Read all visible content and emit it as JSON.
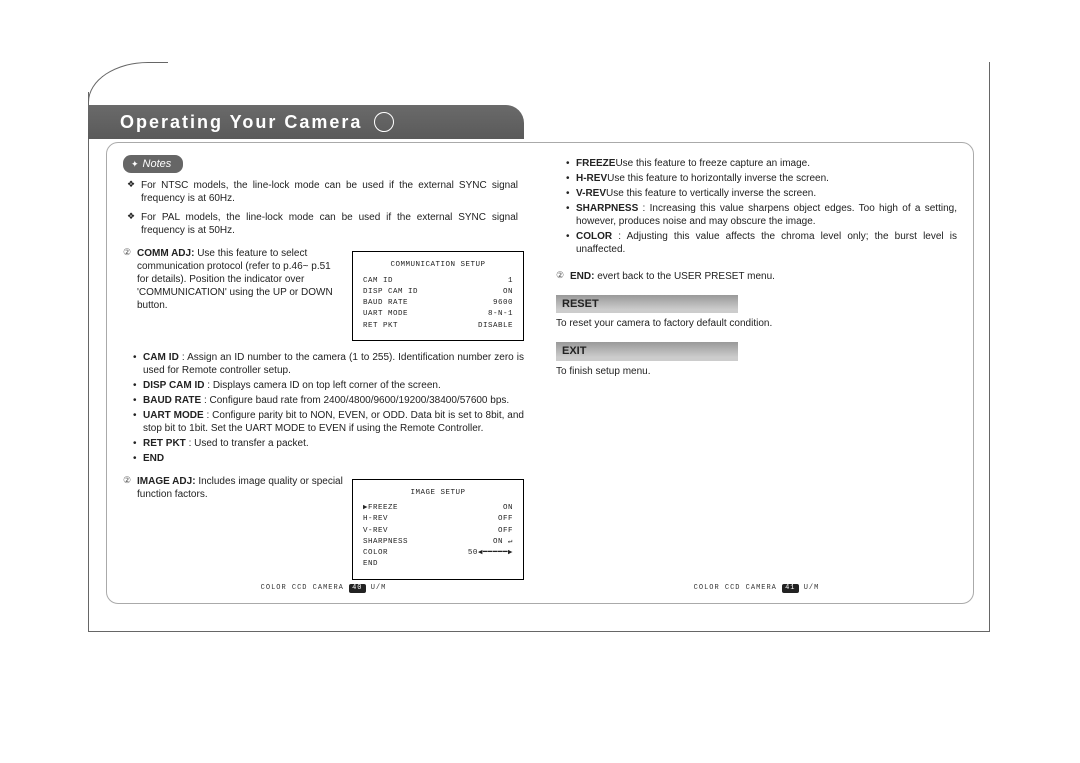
{
  "header": {
    "title": "Operating Your Camera"
  },
  "notes": {
    "label": "Notes"
  },
  "left": {
    "note_ntsc": "For NTSC models, the line-lock mode can be used if the external SYNC signal frequency is at 60Hz.",
    "note_pal": "For PAL models, the line-lock mode  can be used if the external SYNC signal frequency is at 50Hz.",
    "comm_adj_label": "COMM ADJ:",
    "comm_adj_body": "Use this feature to select communication protocol (refer to p.46~ p.51 for details). Position the indicator over 'COMMUNICATION' using the UP or DOWN button.",
    "comm_screen": {
      "title": "COMMUNICATION SETUP",
      "rows": [
        [
          "CAM ID",
          "1"
        ],
        [
          "DISP CAM ID",
          "ON"
        ],
        [
          "BAUD RATE",
          "9600"
        ],
        [
          "UART MODE",
          "8-N-1"
        ],
        [
          "RET PKT",
          "DISABLE"
        ]
      ]
    },
    "cam_id_l": "CAM ID",
    "cam_id_b": ": Assign an ID number to the camera (1 to 255). Identification number zero is used for Remote controller setup.",
    "disp_l": "DISP CAM ID",
    "disp_b": ": Displays camera ID on top left corner of the screen.",
    "baud_l": "BAUD RATE",
    "baud_b": ": Configure baud rate from 2400/4800/9600/19200/38400/57600 bps.",
    "uart_l": "UART MODE",
    "uart_b": ": Configure parity bit to NON, EVEN, or ODD. Data bit is set to 8bit, and stop bit to 1bit. Set the UART MODE to EVEN if using the Remote Controller.",
    "ret_l": "RET PKT",
    "ret_b": ": Used to transfer a packet.",
    "end_l": "END",
    "image_adj_label": "IMAGE ADJ:",
    "image_adj_body": "Includes image quality or special function factors.",
    "image_screen": {
      "title": "IMAGE SETUP",
      "rows": [
        [
          "▶FREEZE",
          "ON"
        ],
        [
          "H-REV",
          "OFF"
        ],
        [
          "V-REV",
          "OFF"
        ],
        [
          "SHARPNESS",
          "ON ↵"
        ],
        [
          "COLOR",
          "50◀━━━━━▶"
        ],
        [
          "END",
          ""
        ]
      ]
    },
    "footer_a": "COLOR CCD CAMERA",
    "footer_pg": "40",
    "footer_b": "U/M"
  },
  "right": {
    "freeze_l": "FREEZE",
    "freeze_b": "Use this feature to freeze capture an image.",
    "hrev_l": "H-REV",
    "hrev_b": "Use this feature to horizontally inverse the screen.",
    "vrev_l": "V-REV",
    "vrev_b": "Use this feature to vertically inverse the screen.",
    "sharp_l": "SHARPNESS",
    "sharp_b": ": Increasing this value sharpens object edges. Too high of a setting, however, produces noise and may obscure the image.",
    "color_l": "COLOR",
    "color_b": ": Adjusting this value affects the chroma level only; the burst level is unaffected.",
    "end_l": "END:",
    "end_b": "evert back to the USER PRESET menu.",
    "reset_h": "RESET",
    "reset_b": "To reset your camera to factory default condition.",
    "exit_h": "EXIT",
    "exit_b": "To finish setup menu.",
    "footer_a": "COLOR CCD CAMERA",
    "footer_pg": "41",
    "footer_b": "U/M"
  }
}
